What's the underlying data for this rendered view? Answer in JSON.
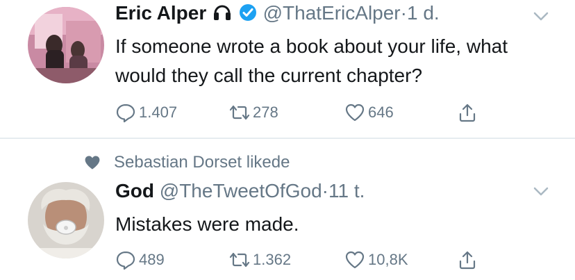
{
  "tweets": [
    {
      "author_name": "Eric Alper",
      "handle": "@ThatEricAlper",
      "separator": "·",
      "time": "1 d.",
      "name_icons": [
        "headphones-icon",
        "verified-badge-icon"
      ],
      "text": "If someone wrote a book about your life, what would they call the current chapter?",
      "actions": {
        "reply_count": "1.407",
        "retweet_count": "278",
        "like_count": "646"
      }
    },
    {
      "social_context": "Sebastian Dorset likede",
      "author_name": "God",
      "handle": "@TheTweetOfGod",
      "separator": "·",
      "time": "11 t.",
      "text": "Mistakes were made.",
      "actions": {
        "reply_count": "489",
        "retweet_count": "1.362",
        "like_count": "10,8K"
      }
    }
  ],
  "colors": {
    "text": "#14171a",
    "muted": "#657786",
    "verified": "#1da1f2",
    "divider": "#e6ecf0"
  },
  "icons": [
    "reply-icon",
    "retweet-icon",
    "like-icon",
    "share-icon",
    "caret-down-icon",
    "heart-filled-icon"
  ]
}
